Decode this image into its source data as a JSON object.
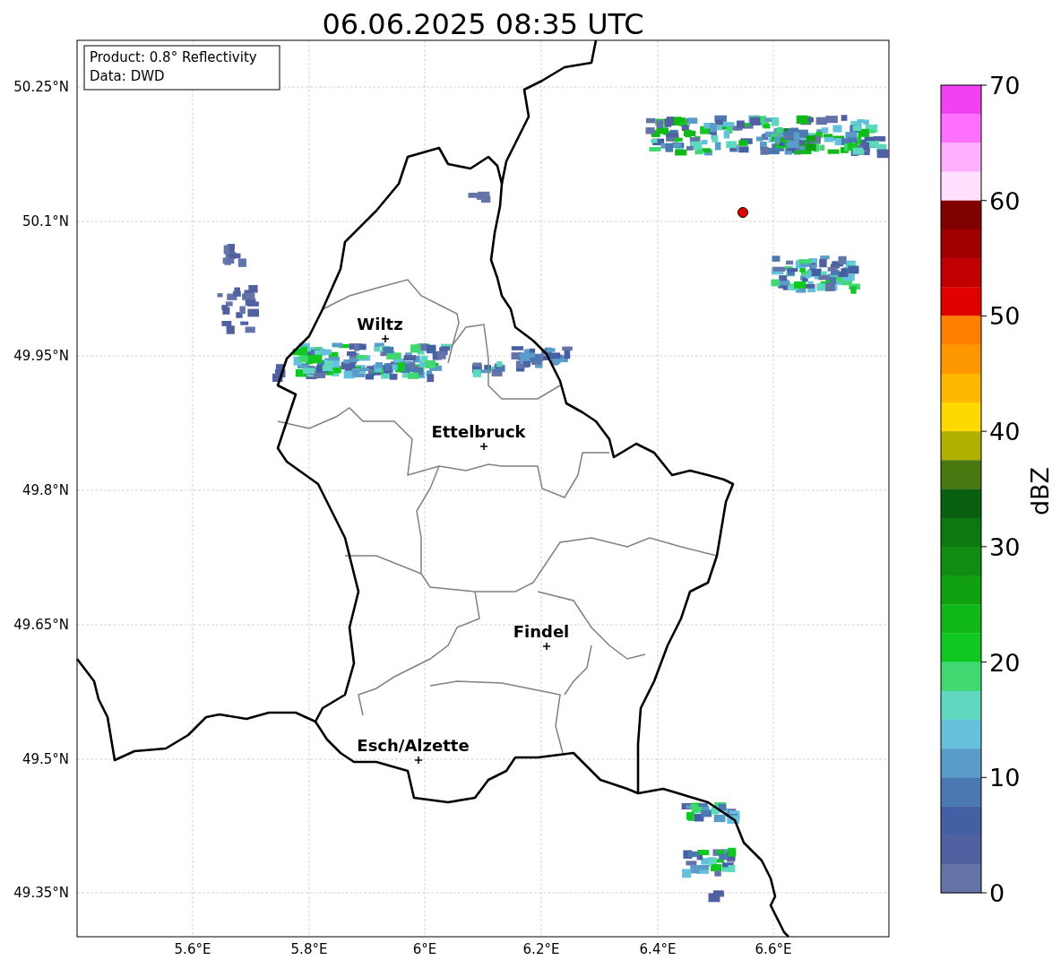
{
  "title": "06.06.2025 08:35 UTC",
  "info_box": [
    "Product: 0.8° Reflectivity",
    "Data: DWD"
  ],
  "y_ticks": [
    "50.25°N",
    "50.1°N",
    "49.95°N",
    "49.8°N",
    "49.65°N",
    "49.5°N",
    "49.35°N"
  ],
  "x_ticks": [
    "5.6°E",
    "5.8°E",
    "6°E",
    "6.2°E",
    "6.4°E",
    "6.6°E"
  ],
  "cities": [
    {
      "name": "Wiltz"
    },
    {
      "name": "Ettelbruck"
    },
    {
      "name": "Findel"
    },
    {
      "name": "Esch/Alzette"
    }
  ],
  "colorbar": {
    "label": "dBZ",
    "ticks": [
      "70",
      "60",
      "50",
      "40",
      "30",
      "20",
      "10",
      "0"
    ],
    "bins": [
      {
        "color": "#f040f0"
      },
      {
        "color": "#ff70ff"
      },
      {
        "color": "#ffb0ff"
      },
      {
        "color": "#ffe0ff"
      },
      {
        "color": "#800000"
      },
      {
        "color": "#a00000"
      },
      {
        "color": "#c00000"
      },
      {
        "color": "#e00000"
      },
      {
        "color": "#ff8000"
      },
      {
        "color": "#ff9800"
      },
      {
        "color": "#ffb800"
      },
      {
        "color": "#ffd800"
      },
      {
        "color": "#b0b000"
      },
      {
        "color": "#487810"
      },
      {
        "color": "#086010"
      },
      {
        "color": "#0c7810"
      },
      {
        "color": "#108c10"
      },
      {
        "color": "#10a010"
      },
      {
        "color": "#10b818"
      },
      {
        "color": "#10c820"
      },
      {
        "color": "#40d870"
      },
      {
        "color": "#60d8c0"
      },
      {
        "color": "#64c0dc"
      },
      {
        "color": "#5a9cc8"
      },
      {
        "color": "#4a78b0"
      },
      {
        "color": "#4460a4"
      },
      {
        "color": "#5060a0"
      },
      {
        "color": "#6474a8"
      }
    ]
  }
}
